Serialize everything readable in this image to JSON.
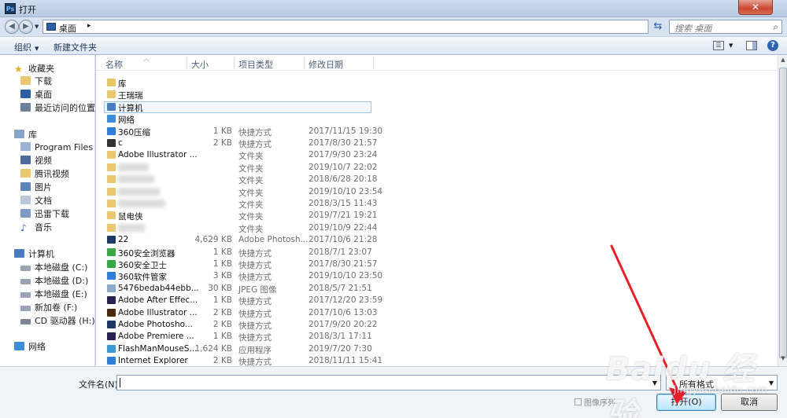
{
  "window": {
    "title": "打开",
    "app_icon_text": "Ps",
    "close_symbol": "✕"
  },
  "address": {
    "location": "桌面",
    "separator": "▸",
    "search_placeholder": "搜索 桌面"
  },
  "toolbar": {
    "organize": "组织",
    "new_folder": "新建文件夹"
  },
  "columns": {
    "name": "名称",
    "size": "大小",
    "type": "项目类型",
    "modified": "修改日期"
  },
  "nav": {
    "favorites": "收藏夹",
    "downloads": "下载",
    "desktop": "桌面",
    "recent": "最近访问的位置",
    "libraries": "库",
    "program_files": "Program Files",
    "videos": "视频",
    "tencent_video": "腾讯视频",
    "pictures": "图片",
    "documents": "文档",
    "xunlei": "迅雷下载",
    "music": "音乐",
    "computer": "计算机",
    "drive_c": "本地磁盘 (C:)",
    "drive_d": "本地磁盘 (D:)",
    "drive_e": "本地磁盘 (E:)",
    "drive_f": "新加卷 (F:)",
    "drive_h": "CD 驱动器 (H:)",
    "network": "网络"
  },
  "files": [
    {
      "name": "库",
      "size": "",
      "type": "",
      "date": "",
      "icon": "library",
      "color": "#e7c66a"
    },
    {
      "name": "王瑞瑞",
      "size": "",
      "type": "",
      "date": "",
      "icon": "user-folder",
      "color": "#e9c86f"
    },
    {
      "name": "计算机",
      "size": "",
      "type": "",
      "date": "",
      "icon": "computer",
      "color": "#4a7dbf",
      "selected": true
    },
    {
      "name": "网络",
      "size": "",
      "type": "",
      "date": "",
      "icon": "network",
      "color": "#3c8fd6"
    },
    {
      "name": "360压缩",
      "size": "1 KB",
      "type": "快捷方式",
      "date": "2017/11/15 19:30",
      "icon": "shortcut",
      "color": "#2f7fd8"
    },
    {
      "name": "c",
      "size": "2 KB",
      "type": "快捷方式",
      "date": "2017/8/30 21:57",
      "icon": "qq",
      "color": "#333333"
    },
    {
      "name": "Adobe Illustrator ...",
      "size": "",
      "type": "文件夹",
      "date": "2017/9/30 23:24",
      "icon": "folder",
      "color": "#e9c86f"
    },
    {
      "name": "",
      "size": "",
      "type": "文件夹",
      "date": "2019/10/7 22:02",
      "icon": "folder",
      "color": "#e9c86f",
      "blurred": true
    },
    {
      "name": "",
      "size": "",
      "type": "文件夹",
      "date": "2018/6/28 20:18",
      "icon": "folder",
      "color": "#e9c86f",
      "blurred": true
    },
    {
      "name": "",
      "size": "",
      "type": "文件夹",
      "date": "2019/10/10 23:54",
      "icon": "folder",
      "color": "#e9c86f",
      "blurred": true
    },
    {
      "name": "",
      "size": "",
      "type": "文件夹",
      "date": "2018/3/15 11:43",
      "icon": "folder",
      "color": "#e9c86f",
      "blurred": true
    },
    {
      "name": "鼠电侠",
      "size": "",
      "type": "文件夹",
      "date": "2019/7/21 19:21",
      "icon": "folder",
      "color": "#e9c86f"
    },
    {
      "name": "",
      "size": "",
      "type": "文件夹",
      "date": "2019/10/9 22:44",
      "icon": "folder",
      "color": "#e9c86f",
      "blurred": true
    },
    {
      "name": "22",
      "size": "4,629 KB",
      "type": "Adobe Photosh...",
      "date": "2017/10/6 21:28",
      "icon": "psd",
      "color": "#1c3a63"
    },
    {
      "name": "360安全浏览器",
      "size": "1 KB",
      "type": "快捷方式",
      "date": "2018/7/1 23:07",
      "icon": "shortcut",
      "color": "#3aa845"
    },
    {
      "name": "360安全卫士",
      "size": "1 KB",
      "type": "快捷方式",
      "date": "2017/8/30 21:57",
      "icon": "shortcut",
      "color": "#3aa845"
    },
    {
      "name": "360软件管家",
      "size": "3 KB",
      "type": "快捷方式",
      "date": "2019/10/10 23:50",
      "icon": "shortcut",
      "color": "#2f7fd8"
    },
    {
      "name": "5476bedab44ebb...",
      "size": "30 KB",
      "type": "JPEG 图像",
      "date": "2018/5/7 21:51",
      "icon": "image",
      "color": "#8fa9c8"
    },
    {
      "name": "Adobe After Effec...",
      "size": "1 KB",
      "type": "快捷方式",
      "date": "2017/12/20 23:59",
      "icon": "shortcut",
      "color": "#2b1f4f"
    },
    {
      "name": "Adobe Illustrator ...",
      "size": "2 KB",
      "type": "快捷方式",
      "date": "2017/10/6 13:03",
      "icon": "shortcut",
      "color": "#4a2a0a"
    },
    {
      "name": "Adobe Photosho...",
      "size": "2 KB",
      "type": "快捷方式",
      "date": "2017/9/20 20:22",
      "icon": "shortcut",
      "color": "#1c3a63"
    },
    {
      "name": "Adobe Premiere ...",
      "size": "1 KB",
      "type": "快捷方式",
      "date": "2018/3/1 17:11",
      "icon": "shortcut",
      "color": "#2b1f4f"
    },
    {
      "name": "FlashManMouseS...",
      "size": "1,624 KB",
      "type": "应用程序",
      "date": "2019/7/20 7:30",
      "icon": "exe",
      "color": "#3a9ad8"
    },
    {
      "name": "Internet Explorer",
      "size": "2 KB",
      "type": "快捷方式",
      "date": "2018/11/11 15:41",
      "icon": "ie",
      "color": "#2f7fd8"
    }
  ],
  "bottom": {
    "filename_label": "文件名(N):",
    "filename_value": "",
    "filter_label": "所有格式",
    "sequence_label": "图像序列",
    "open_button": "打开(O)",
    "cancel_button": "取消"
  },
  "watermark": {
    "brand": "Baidu 经验",
    "url": "jingyan.baidu.com"
  },
  "colors": {
    "accent": "#3c7fb1",
    "annotation_arrow": "#e8202a",
    "selection": "#9ec3eb"
  }
}
